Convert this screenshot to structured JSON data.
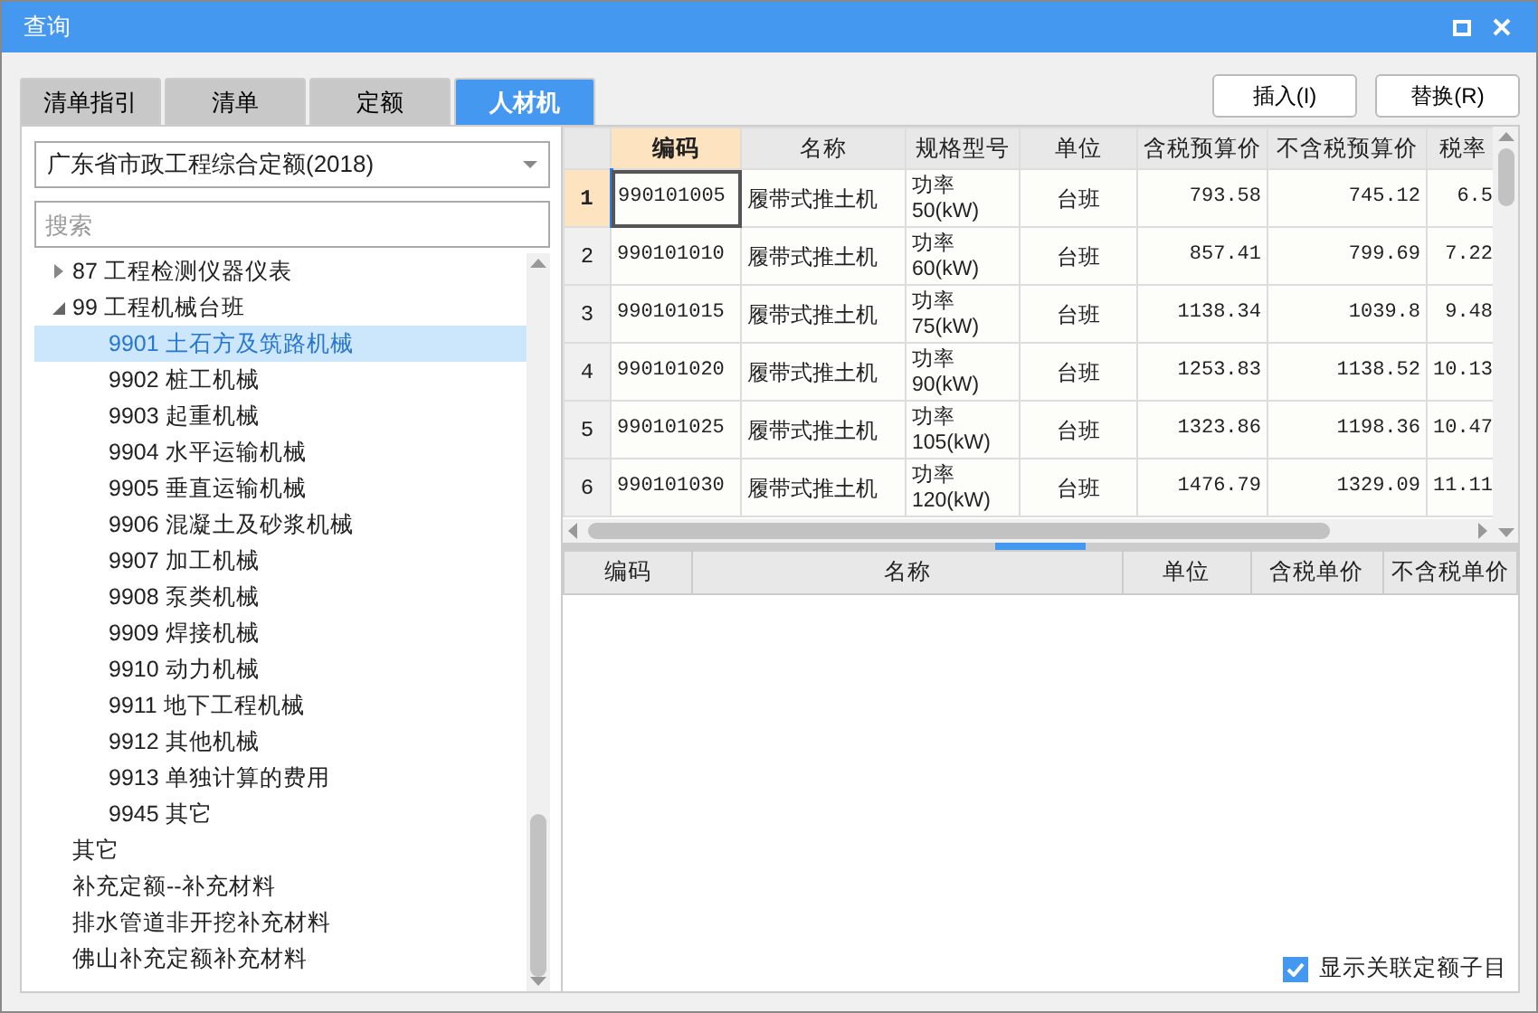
{
  "window": {
    "title": "查询"
  },
  "tabs": [
    {
      "label": "清单指引",
      "selected": false
    },
    {
      "label": "清单",
      "selected": false
    },
    {
      "label": "定额",
      "selected": false
    },
    {
      "label": "人材机",
      "selected": true
    }
  ],
  "buttons": [
    "插入(I)",
    "替换(R)"
  ],
  "library": {
    "value": "广东省市政工程综合定额(2018)"
  },
  "search": {
    "placeholder": "搜索"
  },
  "tree": [
    {
      "label": "87 工程检测仪器仪表",
      "expanded": false,
      "selected": false
    },
    {
      "label": "99 工程机械台班",
      "expanded": true,
      "selected": false,
      "children": [
        {
          "label": "9901 土石方及筑路机械",
          "selected": true
        },
        {
          "label": "9902 桩工机械",
          "selected": false
        },
        {
          "label": "9903 起重机械",
          "selected": false
        },
        {
          "label": "9904 水平运输机械",
          "selected": false
        },
        {
          "label": "9905 垂直运输机械",
          "selected": false
        },
        {
          "label": "9906 混凝土及砂浆机械",
          "selected": false
        },
        {
          "label": "9907 加工机械",
          "selected": false
        },
        {
          "label": "9908 泵类机械",
          "selected": false
        },
        {
          "label": "9909 焊接机械",
          "selected": false
        },
        {
          "label": "9910 动力机械",
          "selected": false
        },
        {
          "label": "9911 地下工程机械",
          "selected": false
        },
        {
          "label": "9912 其他机械",
          "selected": false
        },
        {
          "label": "9913 单独计算的费用",
          "selected": false
        },
        {
          "label": "9945 其它",
          "selected": false
        }
      ]
    },
    {
      "label": "其它",
      "selected": false
    },
    {
      "label": "补充定额--补充材料",
      "selected": false
    },
    {
      "label": "排水管道非开挖补充材料",
      "selected": false
    },
    {
      "label": "佛山补充定额补充材料",
      "selected": false
    }
  ],
  "table": {
    "columns": [
      {
        "label": "编码",
        "selected": true
      },
      {
        "label": "名称",
        "selected": false
      },
      {
        "label": "规格型号",
        "selected": false
      },
      {
        "label": "单位",
        "selected": false
      },
      {
        "label": "含税预算价",
        "selected": false
      },
      {
        "label": "不含税预算价",
        "selected": false
      },
      {
        "label": "税率",
        "selected": false
      }
    ],
    "rows": [
      {
        "number": "1",
        "selected": true,
        "cells": [
          "990101005",
          "履带式推土机",
          "功率\n50(kW)",
          "台班",
          "793.58",
          "745.12",
          "6.5"
        ]
      },
      {
        "number": "2",
        "selected": false,
        "cells": [
          "990101010",
          "履带式推土机",
          "功率\n60(kW)",
          "台班",
          "857.41",
          "799.69",
          "7.22"
        ]
      },
      {
        "number": "3",
        "selected": false,
        "cells": [
          "990101015",
          "履带式推土机",
          "功率\n75(kW)",
          "台班",
          "1138.34",
          "1039.8",
          "9.48"
        ]
      },
      {
        "number": "4",
        "selected": false,
        "cells": [
          "990101020",
          "履带式推土机",
          "功率\n90(kW)",
          "台班",
          "1253.83",
          "1138.52",
          "10.13"
        ]
      },
      {
        "number": "5",
        "selected": false,
        "cells": [
          "990101025",
          "履带式推土机",
          "功率\n105(kW)",
          "台班",
          "1323.86",
          "1198.36",
          "10.47"
        ]
      },
      {
        "number": "6",
        "selected": false,
        "cells": [
          "990101030",
          "履带式推土机",
          "功率\n120(kW)",
          "台班",
          "1476.79",
          "1329.09",
          "11.11"
        ]
      }
    ]
  },
  "sub_table": {
    "columns": [
      "编码",
      "名称",
      "单位",
      "含税单价",
      "不含税单价"
    ]
  },
  "show_linked": {
    "label": "显示关联定额子目",
    "checked": true
  }
}
